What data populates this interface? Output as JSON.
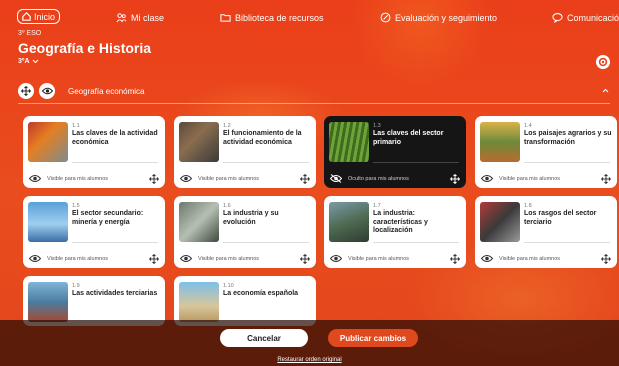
{
  "nav": {
    "home": "Inicio",
    "mi_clase": "Mi clase",
    "biblioteca": "Biblioteca de recursos",
    "evaluacion": "Evaluación y seguimiento",
    "comunicacion": "Comunicación"
  },
  "header": {
    "breadcrumb": "3º ESO",
    "title": "Geografía e Historia",
    "group": "3ºA"
  },
  "section": {
    "label": "Geografía económica"
  },
  "cards": [
    {
      "num": "1.1",
      "title": "Las claves de la actividad económica",
      "visibility": "Visible para mis alumnos",
      "hidden": false
    },
    {
      "num": "1.2",
      "title": "El funcionamiento de la actividad económica",
      "visibility": "Visible para mis alumnos",
      "hidden": false
    },
    {
      "num": "1.3",
      "title": "Las claves del sector primario",
      "visibility": "Oculto para mis alumnos",
      "hidden": true
    },
    {
      "num": "1.4",
      "title": "Los paisajes agrarios y su transformación",
      "visibility": "Visible para mis alumnos",
      "hidden": false
    },
    {
      "num": "1.5",
      "title": "El sector secundario: minería y energía",
      "visibility": "Visible para mis alumnos",
      "hidden": false
    },
    {
      "num": "1.6",
      "title": "La industria y su evolución",
      "visibility": "Visible para mis alumnos",
      "hidden": false
    },
    {
      "num": "1.7",
      "title": "La industria: características y localización",
      "visibility": "Visible para mis alumnos",
      "hidden": false
    },
    {
      "num": "1.8",
      "title": "Los rasgos del sector terciario",
      "visibility": "Visible para mis alumnos",
      "hidden": false
    },
    {
      "num": "1.9",
      "title": "Las actividades terciarias",
      "visibility": "",
      "hidden": false
    },
    {
      "num": "1.10",
      "title": "La economía española",
      "visibility": "",
      "hidden": false
    }
  ],
  "actions": {
    "cancel": "Cancelar",
    "publish": "Publicar cambios",
    "restore": "Restaurar orden original"
  },
  "colors": {
    "brand": "#e8421c",
    "publish": "#e0481d",
    "dark_card": "#151515"
  }
}
